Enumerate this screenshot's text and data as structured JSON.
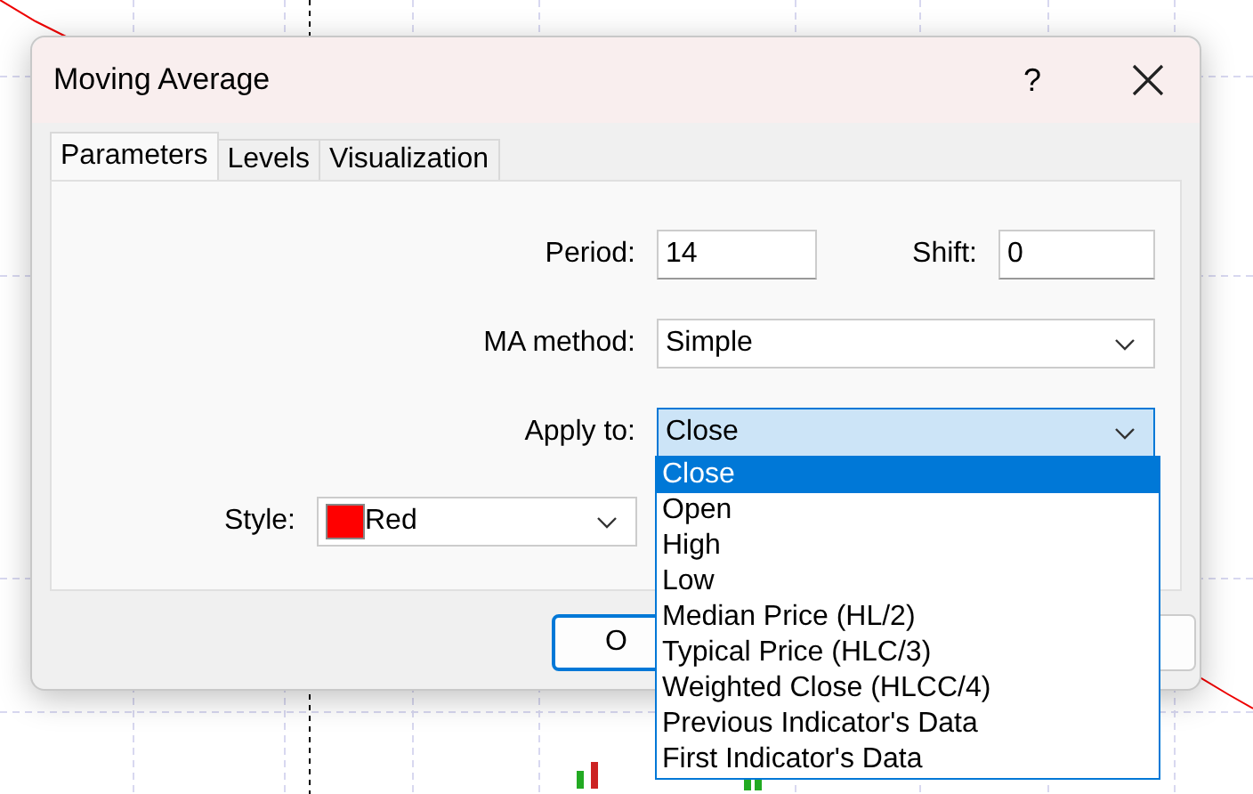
{
  "window": {
    "title": "Moving Average",
    "help": "?"
  },
  "tabs": [
    {
      "label": "Parameters",
      "selected": true
    },
    {
      "label": "Levels",
      "selected": false
    },
    {
      "label": "Visualization",
      "selected": false
    }
  ],
  "period": {
    "label": "Period:",
    "value": "14"
  },
  "shift": {
    "label": "Shift:",
    "value": "0"
  },
  "ma_method": {
    "label": "MA method:",
    "value": "Simple"
  },
  "apply_to": {
    "label": "Apply to:",
    "value": "Close",
    "expanded": true,
    "options": [
      {
        "label": "Close",
        "selected": true
      },
      {
        "label": "Open",
        "selected": false
      },
      {
        "label": "High",
        "selected": false
      },
      {
        "label": "Low",
        "selected": false
      },
      {
        "label": "Median Price (HL/2)",
        "selected": false
      },
      {
        "label": "Typical Price (HLC/3)",
        "selected": false
      },
      {
        "label": "Weighted Close (HLCC/4)",
        "selected": false
      },
      {
        "label": "Previous Indicator's Data",
        "selected": false
      },
      {
        "label": "First Indicator's Data",
        "selected": false
      }
    ]
  },
  "style": {
    "label": "Style:",
    "value": "Red",
    "color": "#ff0000"
  },
  "ok_button": {
    "label": "O"
  }
}
